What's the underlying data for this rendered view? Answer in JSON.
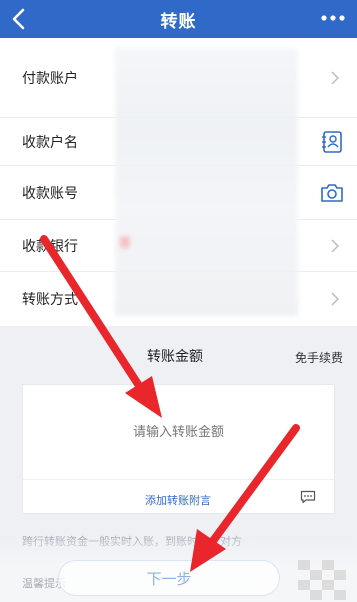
{
  "nav": {
    "title": "转账"
  },
  "rows": [
    {
      "label": "付款账户"
    },
    {
      "label": "收款户名"
    },
    {
      "label": "收款账号"
    },
    {
      "label": "收款银行"
    },
    {
      "label": "转账方式"
    }
  ],
  "amount": {
    "title": "转账金额",
    "fee": "免手续费",
    "placeholder": "请输入转账金额",
    "memo_link": "添加转账附言"
  },
  "notice": "跨行转账资金一般实时入账，到账时间以对方",
  "tips": "温馨提示",
  "next_button": "下一步",
  "colors": {
    "nav": "#3169c8",
    "arrow": "#e8262c",
    "link": "#3169c8"
  },
  "icons": [
    "back-icon",
    "more-icon",
    "chevron-right-icon",
    "contacts-icon",
    "camera-icon",
    "chat-icon"
  ]
}
